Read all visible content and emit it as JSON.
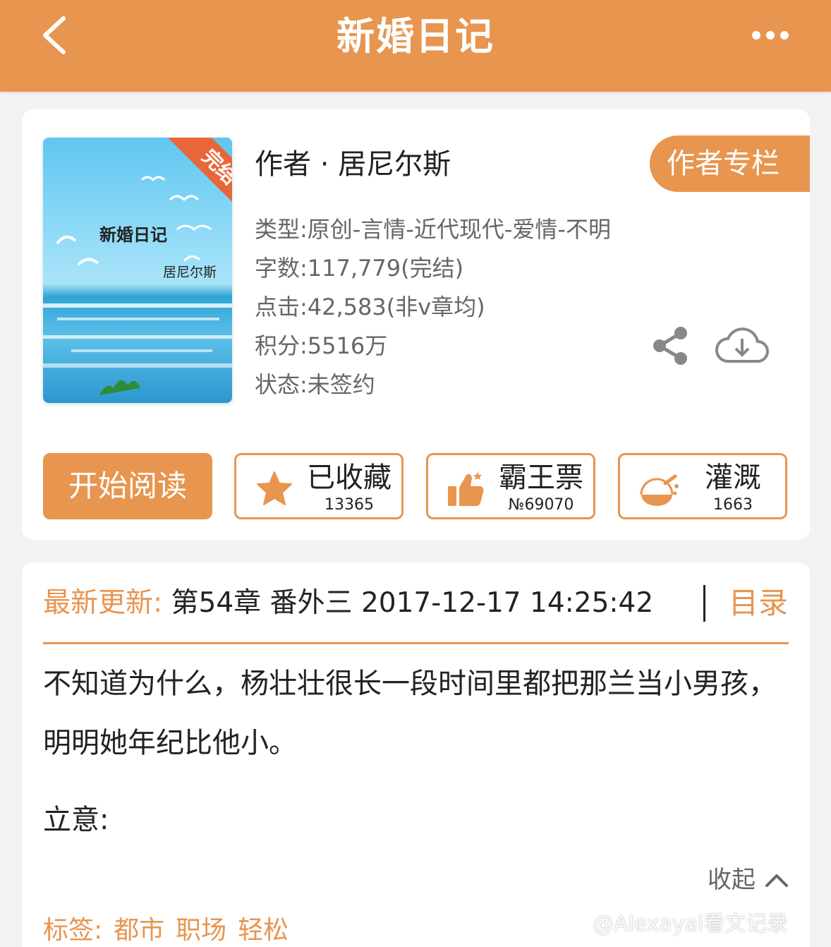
{
  "header": {
    "title": "新婚日记"
  },
  "book": {
    "cover_title": "新婚日记",
    "cover_author": "居尼尔斯",
    "cover_ribbon": "完结",
    "author": "作者 · 居尼尔斯",
    "author_column_label": "作者专栏",
    "type": "类型:原创-言情-近代现代-爱情-不明",
    "words": "字数:117,779(完结)",
    "clicks": "点击:42,583(非v章均)",
    "score": "积分:5516万",
    "status": "状态:未签约"
  },
  "actions": {
    "read_label": "开始阅读",
    "favorite": {
      "label": "已收藏",
      "count": "13365"
    },
    "vote": {
      "label": "霸王票",
      "count": "№69070"
    },
    "irrigate": {
      "label": "灌溉",
      "count": "1663"
    }
  },
  "update": {
    "label": "最新更新:",
    "text": " 第54章 番外三 2017-12-17 14:25:42",
    "toc_label": "目录"
  },
  "description": {
    "text": "不知道为什么，杨壮壮很长一段时间里都把那兰当小男孩，明明她年纪比他小。",
    "liyi_label": "立意:",
    "collapse_label": "收起"
  },
  "tags": {
    "label": "标签:",
    "items": [
      "都市",
      "职场",
      "轻松"
    ]
  },
  "watermark": "@Alexayal看文记录",
  "colors": {
    "accent": "#e8954f",
    "ribbon": "#e8663a"
  },
  "icons": [
    "back-icon",
    "more-icon",
    "share-icon",
    "download-icon",
    "star-icon",
    "thumbs-up-icon",
    "watering-icon",
    "chevron-up-icon"
  ]
}
